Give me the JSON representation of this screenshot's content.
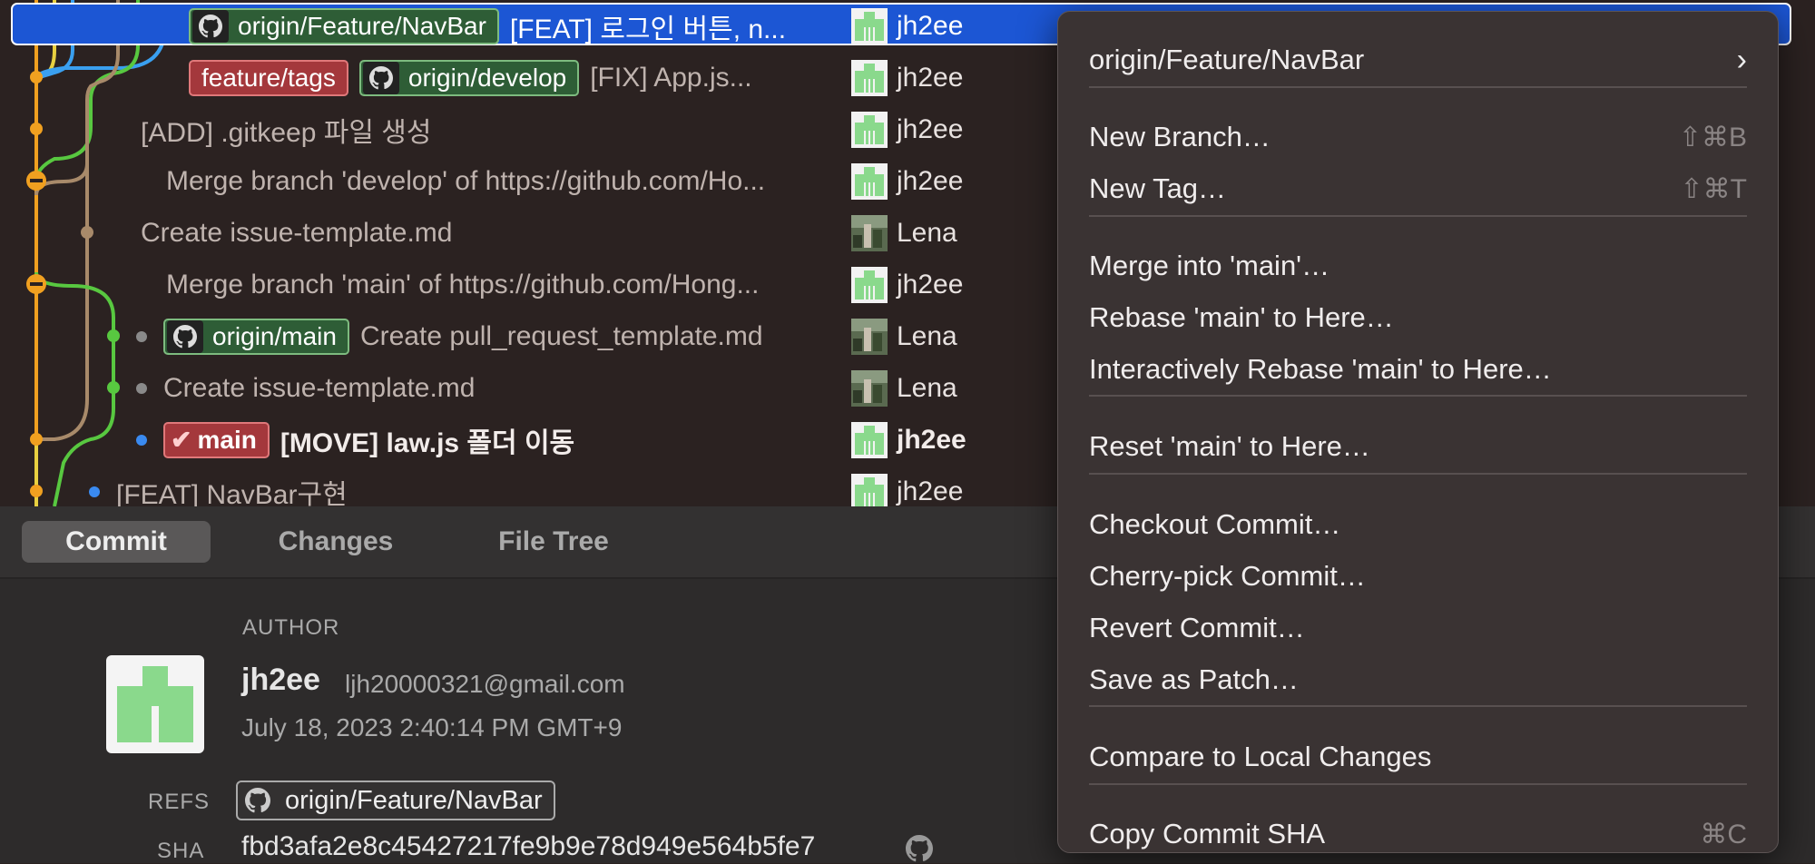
{
  "commits": [
    {
      "tags": [
        {
          "kind": "remote",
          "label": "origin/Feature/NavBar"
        }
      ],
      "message": "[FEAT] 로그인 버튼, n...",
      "author": "jh2ee",
      "avatar": "identicon"
    },
    {
      "tags": [
        {
          "kind": "local",
          "label": "feature/tags"
        },
        {
          "kind": "remote",
          "label": "origin/develop"
        }
      ],
      "message": "[FIX] App.js...",
      "author": "jh2ee",
      "avatar": "identicon"
    },
    {
      "tags": [],
      "message": "[ADD] .gitkeep 파일 생성",
      "author": "jh2ee",
      "avatar": "identicon"
    },
    {
      "tags": [],
      "message": "Merge branch 'develop' of https://github.com/Ho...",
      "author": "jh2ee",
      "avatar": "identicon"
    },
    {
      "tags": [],
      "message": "Create issue-template.md",
      "author": "Lena",
      "avatar": "photo"
    },
    {
      "tags": [],
      "message": "Merge branch 'main' of https://github.com/Hong...",
      "author": "jh2ee",
      "avatar": "identicon"
    },
    {
      "tags": [
        {
          "kind": "remote",
          "label": "origin/main"
        }
      ],
      "message": "Create pull_request_template.md",
      "author": "Lena",
      "avatar": "photo"
    },
    {
      "tags": [],
      "message": "Create issue-template.md",
      "author": "Lena",
      "avatar": "photo"
    },
    {
      "tags": [
        {
          "kind": "check",
          "label": "main"
        }
      ],
      "message": "[MOVE] law.js 폴더 이동",
      "author": "jh2ee",
      "avatar": "identicon"
    },
    {
      "tags": [],
      "message": "[FEAT] NavBar구현",
      "author": "jh2ee",
      "avatar": "identicon"
    }
  ],
  "tabs": {
    "commit": "Commit",
    "changes": "Changes",
    "file_tree": "File Tree"
  },
  "details": {
    "author_label": "AUTHOR",
    "author_name": "jh2ee",
    "author_email": "ljh20000321@gmail.com",
    "date": "July 18, 2023 2:40:14 PM GMT+9",
    "refs_label": "REFS",
    "ref": "origin/Feature/NavBar",
    "sha_label": "SHA",
    "sha": "fbd3afa2e8c45427217fe9b9e78d949e564b5fe7"
  },
  "menu": {
    "header": "origin/Feature/NavBar",
    "new_branch": "New Branch…",
    "new_branch_sc": "⇧⌘B",
    "new_tag": "New Tag…",
    "new_tag_sc": "⇧⌘T",
    "merge": "Merge into 'main'…",
    "rebase": "Rebase 'main' to Here…",
    "irebase": "Interactively Rebase 'main' to Here…",
    "reset": "Reset 'main' to Here…",
    "checkout": "Checkout Commit…",
    "cherry": "Cherry-pick Commit…",
    "revert": "Revert Commit…",
    "patch": "Save as Patch…",
    "compare": "Compare to Local Changes",
    "copy_sha": "Copy Commit SHA",
    "copy_sha_sc": "⌘C"
  },
  "colors": {
    "selection": "#1c56d4",
    "remote_tag": "#2e5d36",
    "local_tag": "#a4383c",
    "lane_orange": "#f0a020",
    "lane_yellow": "#e8d040",
    "lane_blue": "#3aa0f0",
    "lane_tan": "#a88a6a",
    "lane_green": "#58c840"
  }
}
